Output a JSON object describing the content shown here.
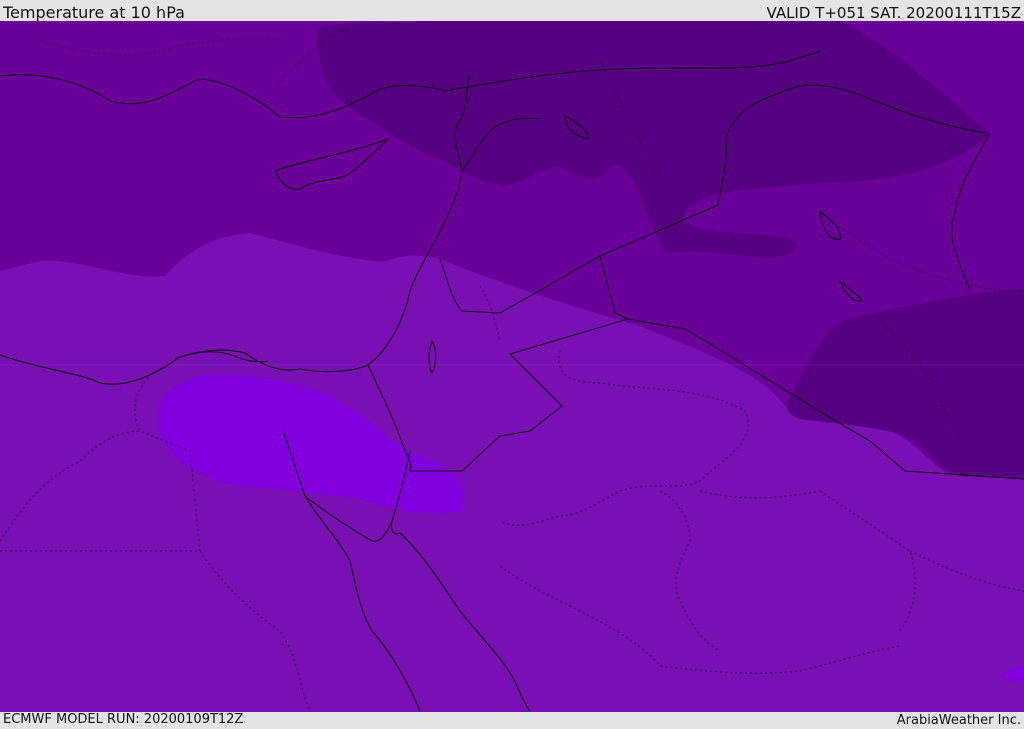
{
  "header": {
    "title": "Temperature at 10 hPa",
    "valid": "VALID T+051 SAT. 20200111T15Z"
  },
  "footer": {
    "model_run": "ECMWF MODEL RUN: 20200109T12Z",
    "credit": "ArabiaWeather Inc."
  },
  "map": {
    "colors": {
      "very_cold": "#560082",
      "cold": "#6a0099",
      "medium": "#7a10b4",
      "warm": "#8200e0",
      "coast": "#111111"
    }
  }
}
